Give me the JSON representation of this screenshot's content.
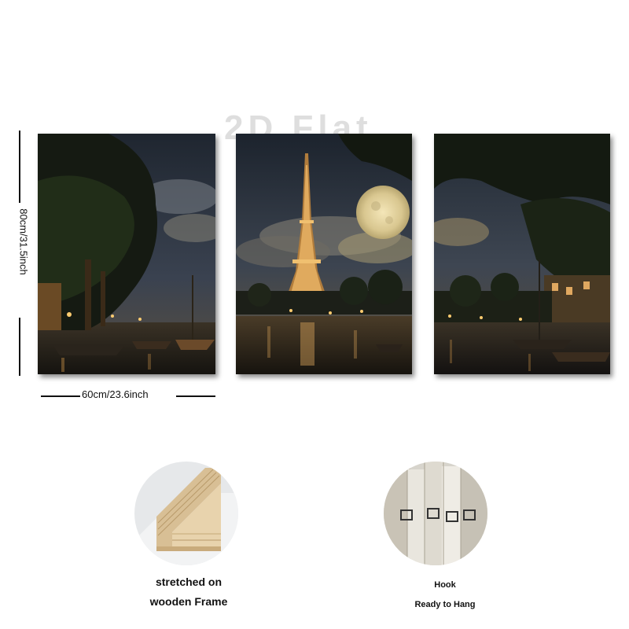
{
  "watermark": "2D Flat",
  "dimensions": {
    "height_label": "80cm/31.5inch",
    "width_label": "60cm/23.6inch"
  },
  "panels": [
    {
      "name": "left",
      "scene": "riverbank trees and moored boats at night"
    },
    {
      "name": "center",
      "scene": "Eiffel Tower under full moon reflected in river"
    },
    {
      "name": "right",
      "scene": "river with trees and lit buildings at night"
    }
  ],
  "features": {
    "frame": {
      "line1": "stretched on",
      "line2": "wooden Frame"
    },
    "hook": {
      "line1": "Hook",
      "line2": "Ready to Hang"
    }
  },
  "colors": {
    "background": "#ffffff",
    "night_sky": "#2b3340",
    "moon": "#e8d9a8",
    "tower_glow": "#d9a35a",
    "wood": "#d8bf95"
  }
}
